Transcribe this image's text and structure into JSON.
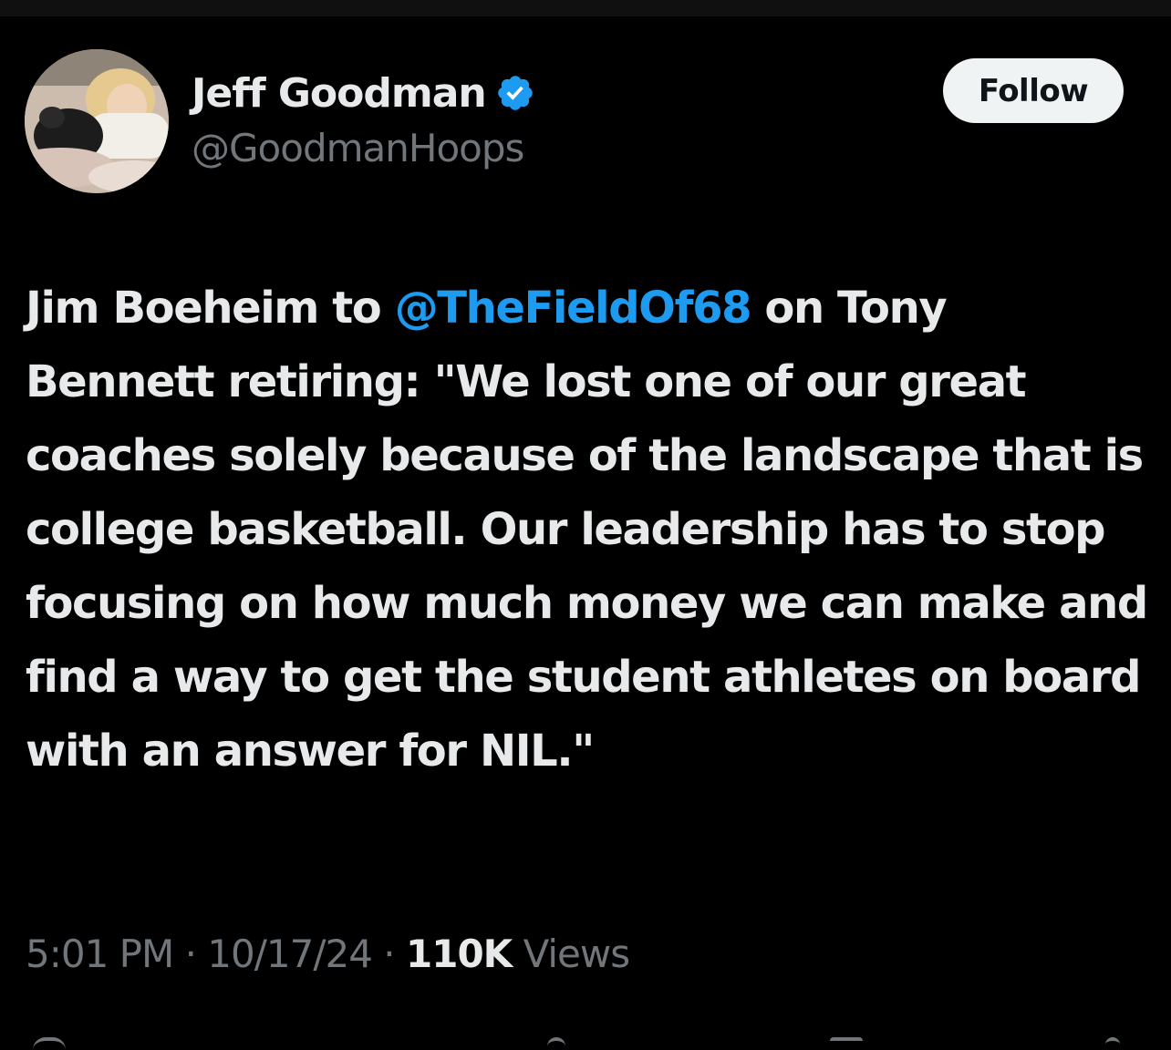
{
  "author": {
    "display_name": "Jeff Goodman",
    "handle": "@GoodmanHoops",
    "verified": true,
    "avatar_icon": "profile-photo",
    "verified_color": "#1d9bf0"
  },
  "follow_button": {
    "label": "Follow"
  },
  "tweet": {
    "text_before_mention": "Jim Boeheim to ",
    "mention": "@TheFieldOf68",
    "text_after_mention": " on Tony Bennett retiring: \"We lost one of our great coaches solely because of the landscape that is college basketball. Our leadership has to stop focusing on how much money we can make and find a way to get the student athletes on board with an answer for NIL.\""
  },
  "meta": {
    "time": "5:01 PM",
    "separator": " · ",
    "date": "10/17/24",
    "views_count": "110K",
    "views_label": " Views"
  },
  "colors": {
    "background": "#000000",
    "text": "#e7e9ea",
    "secondary_text": "#71767b",
    "link": "#1d9bf0"
  }
}
